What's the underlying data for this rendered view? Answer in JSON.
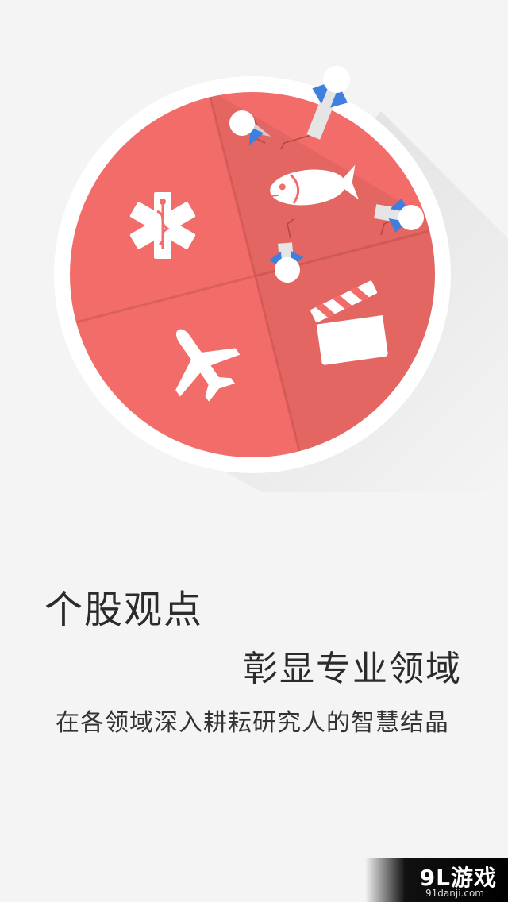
{
  "hero": {
    "title": "个股观点",
    "subtitle": "彰显专业领域",
    "description": "在各领域深入耕耘研究人的智慧结晶",
    "icons": [
      "medical-star-of-life-icon",
      "fish-icon",
      "airplane-icon",
      "film-clapperboard-icon",
      "push-pin-icon"
    ]
  },
  "watermark": {
    "logo_text": "9L游戏",
    "url_text": "91danji.com"
  },
  "colors": {
    "background": "#f4f4f4",
    "disc_red": "#f26d6a",
    "ring_white": "#ffffff",
    "pin_blue": "#3f7fe0"
  }
}
